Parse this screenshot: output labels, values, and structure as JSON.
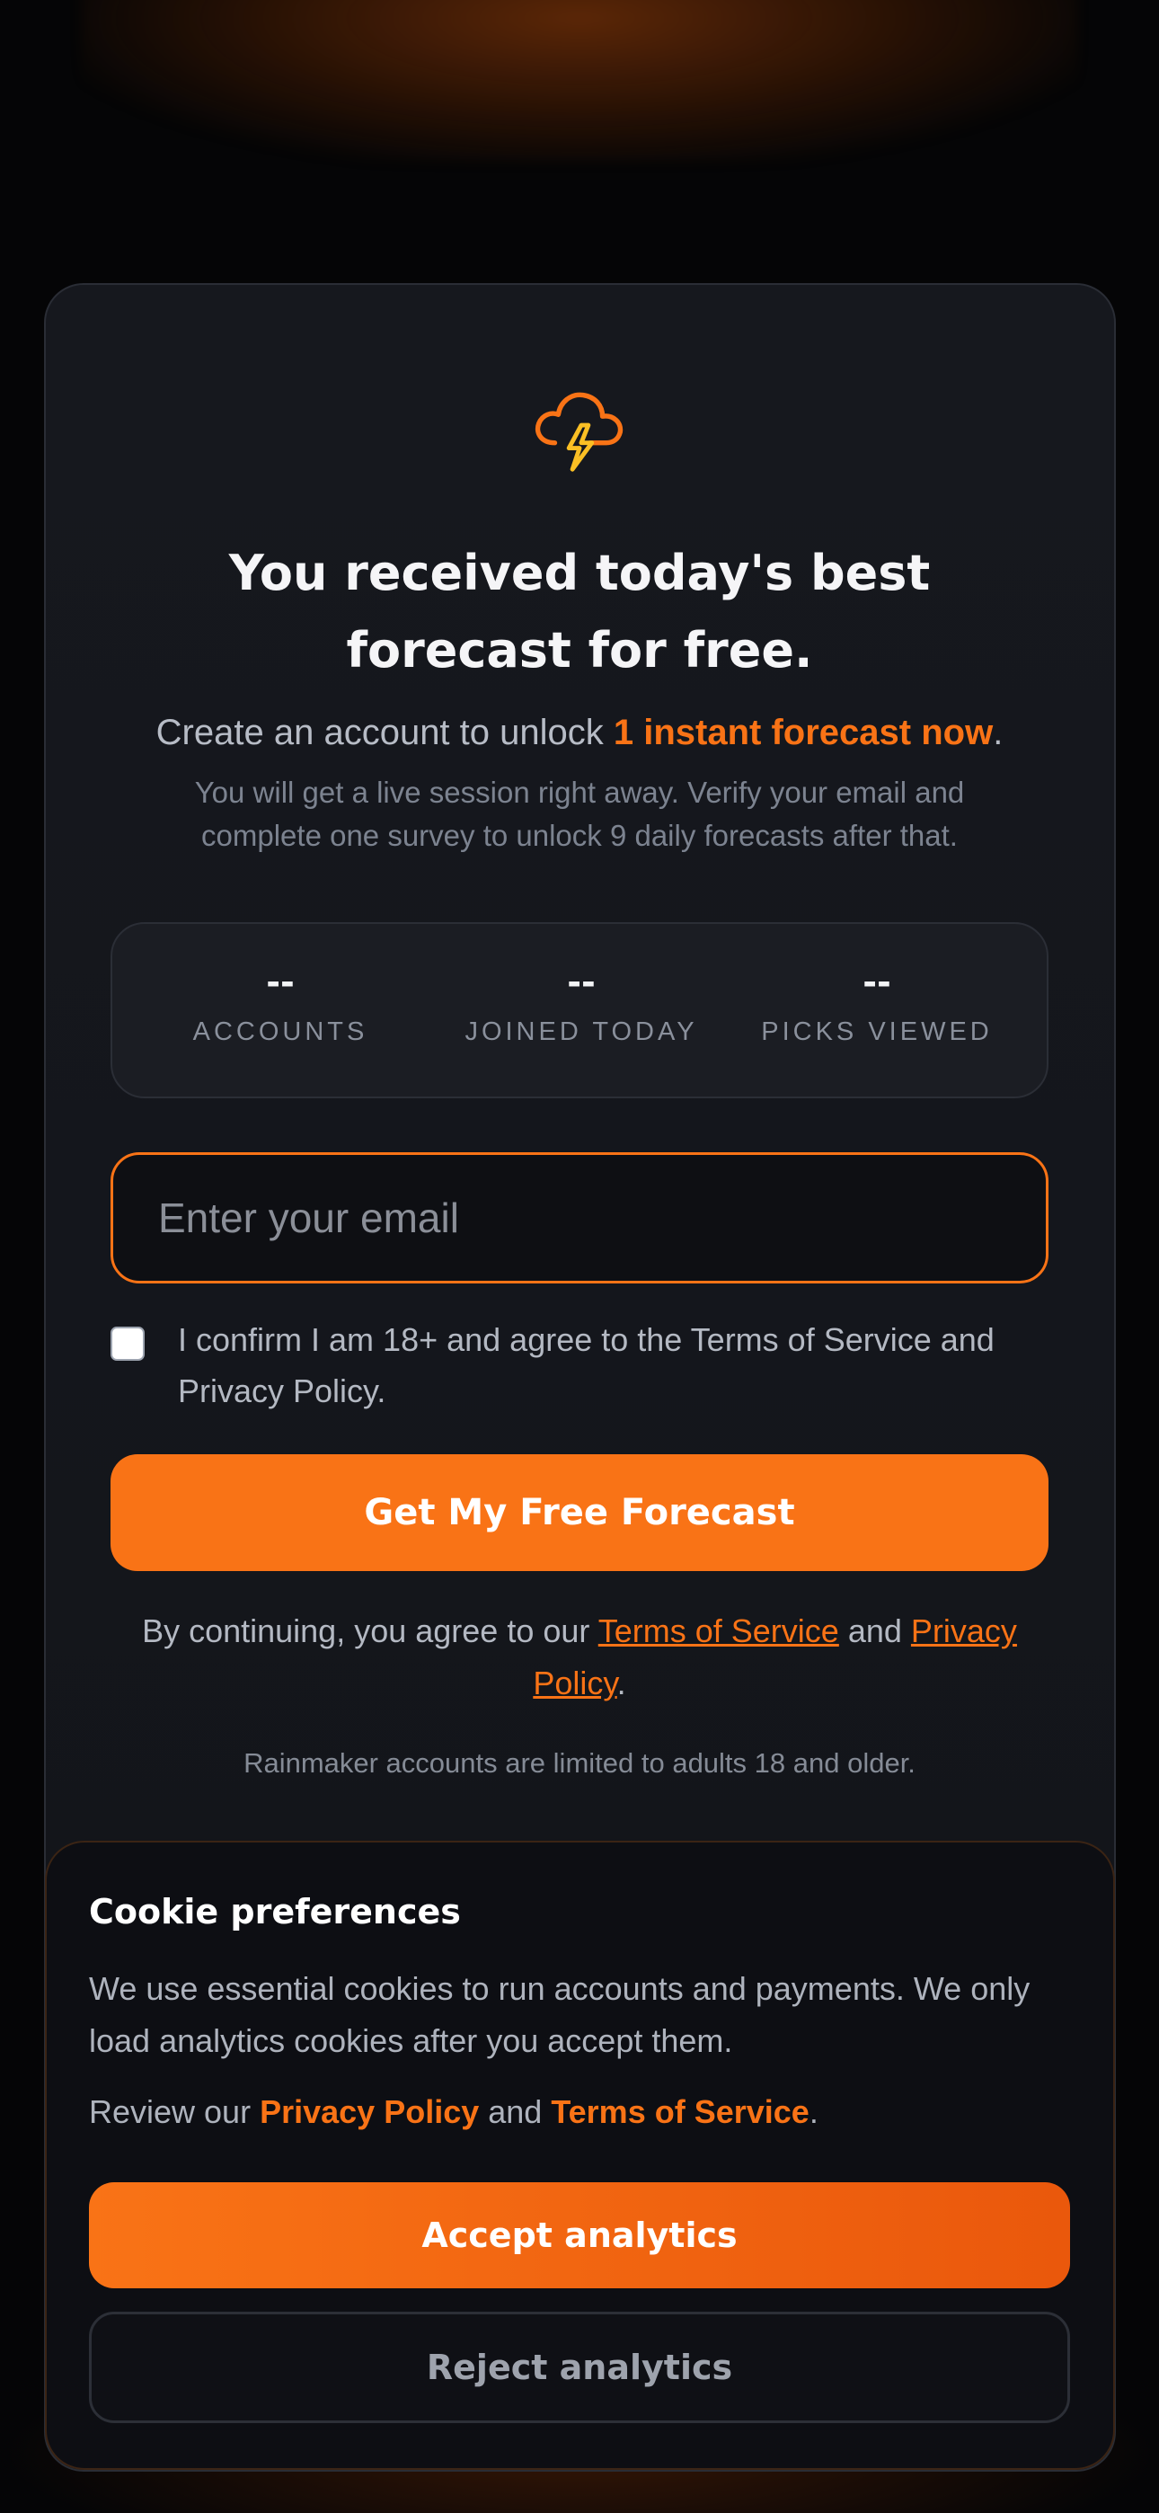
{
  "hero": {
    "icon": "storm-cloud-lightning-icon",
    "headline": "You received today's best forecast for free.",
    "subhead_prefix": "Create an account to unlock ",
    "subhead_highlight": "1 instant forecast now",
    "subhead_suffix": ".",
    "subnote": "You will get a live session right away. Verify your email and complete one survey to unlock 9 daily forecasts after that."
  },
  "stats": [
    {
      "value": "--",
      "label": "ACCOUNTS"
    },
    {
      "value": "--",
      "label": "JOINED TODAY"
    },
    {
      "value": "--",
      "label": "PICKS VIEWED"
    }
  ],
  "form": {
    "email_placeholder": "Enter your email",
    "email_value": "",
    "consent_label": "I confirm I am 18+ and agree to the Terms of Service and Privacy Policy.",
    "consent_checked": false,
    "submit_label": "Get My Free Forecast"
  },
  "legal": {
    "prefix": "By continuing, you agree to our ",
    "terms_link": "Terms of Service",
    "middle": " and ",
    "privacy_link": "Privacy Policy",
    "suffix": ".",
    "age_note": "Rainmaker accounts are limited to adults 18 and older."
  },
  "cookie_banner": {
    "title": "Cookie preferences",
    "text": "We use essential cookies to run accounts and payments. We only load analytics cookies after you accept them.",
    "review_prefix": "Review our ",
    "privacy_link": "Privacy Policy",
    "middle": " and ",
    "terms_link": "Terms of Service",
    "suffix": ".",
    "accept_label": "Accept analytics",
    "reject_label": "Reject analytics"
  },
  "colors": {
    "accent": "#f97316",
    "background": "#050506",
    "card": "#14161b"
  }
}
